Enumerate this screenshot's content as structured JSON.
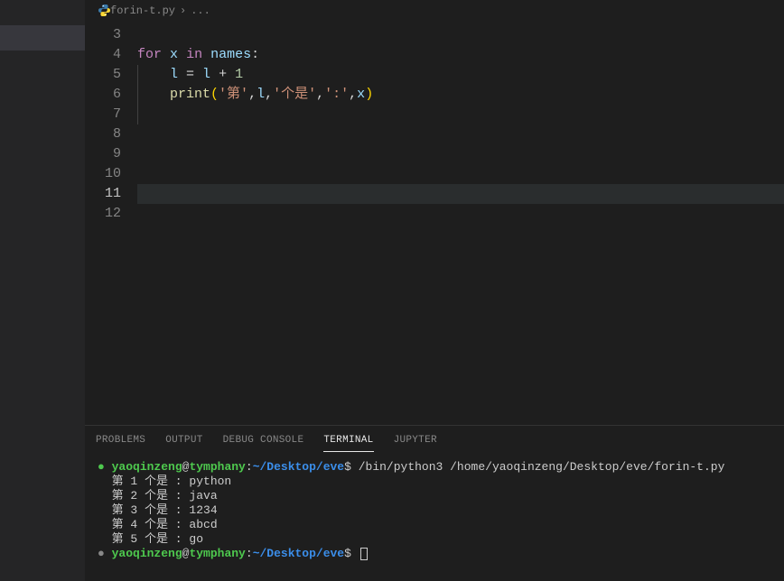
{
  "breadcrumb": {
    "filename": "forin-t.py",
    "trail": "..."
  },
  "editor": {
    "lines": [
      {
        "num": "3",
        "tokens": []
      },
      {
        "num": "4",
        "tokens": [
          {
            "cls": "tok-keyword",
            "text": "for"
          },
          {
            "cls": "tok-op",
            "text": " "
          },
          {
            "cls": "tok-var",
            "text": "x"
          },
          {
            "cls": "tok-op",
            "text": " "
          },
          {
            "cls": "tok-keyword",
            "text": "in"
          },
          {
            "cls": "tok-op",
            "text": " "
          },
          {
            "cls": "tok-var",
            "text": "names"
          },
          {
            "cls": "tok-op",
            "text": ":"
          }
        ]
      },
      {
        "num": "5",
        "tokens": [
          {
            "cls": "tok-op",
            "text": "    "
          },
          {
            "cls": "tok-var",
            "text": "l"
          },
          {
            "cls": "tok-op",
            "text": " = "
          },
          {
            "cls": "tok-var",
            "text": "l"
          },
          {
            "cls": "tok-op",
            "text": " + "
          },
          {
            "cls": "tok-num",
            "text": "1"
          }
        ]
      },
      {
        "num": "6",
        "tokens": [
          {
            "cls": "tok-op",
            "text": "    "
          },
          {
            "cls": "tok-func",
            "text": "print"
          },
          {
            "cls": "tok-paren",
            "text": "("
          },
          {
            "cls": "tok-string",
            "text": "'第'"
          },
          {
            "cls": "tok-comma",
            "text": ","
          },
          {
            "cls": "tok-var",
            "text": "l"
          },
          {
            "cls": "tok-comma",
            "text": ","
          },
          {
            "cls": "tok-string",
            "text": "'个是'"
          },
          {
            "cls": "tok-comma",
            "text": ","
          },
          {
            "cls": "tok-string",
            "text": "':'"
          },
          {
            "cls": "tok-comma",
            "text": ","
          },
          {
            "cls": "tok-var",
            "text": "x"
          },
          {
            "cls": "tok-paren",
            "text": ")"
          }
        ]
      },
      {
        "num": "7",
        "tokens": []
      },
      {
        "num": "8",
        "tokens": []
      },
      {
        "num": "9",
        "tokens": []
      },
      {
        "num": "10",
        "tokens": []
      },
      {
        "num": "11",
        "tokens": [],
        "active": true
      },
      {
        "num": "12",
        "tokens": []
      }
    ]
  },
  "panel": {
    "tabs": {
      "problems": "PROBLEMS",
      "output": "OUTPUT",
      "debug": "DEBUG CONSOLE",
      "terminal": "TERMINAL",
      "jupyter": "JUPYTER"
    }
  },
  "terminal": {
    "user": "yaoqinzeng",
    "host": "tymphany",
    "path": "~/Desktop/eve",
    "command": "/bin/python3 /home/yaoqinzeng/Desktop/eve/forin-t.py",
    "output": [
      "第 1 个是 : python",
      "第 2 个是 : java",
      "第 3 个是 : 1234",
      "第 4 个是 : abcd",
      "第 5 个是 : go"
    ]
  }
}
